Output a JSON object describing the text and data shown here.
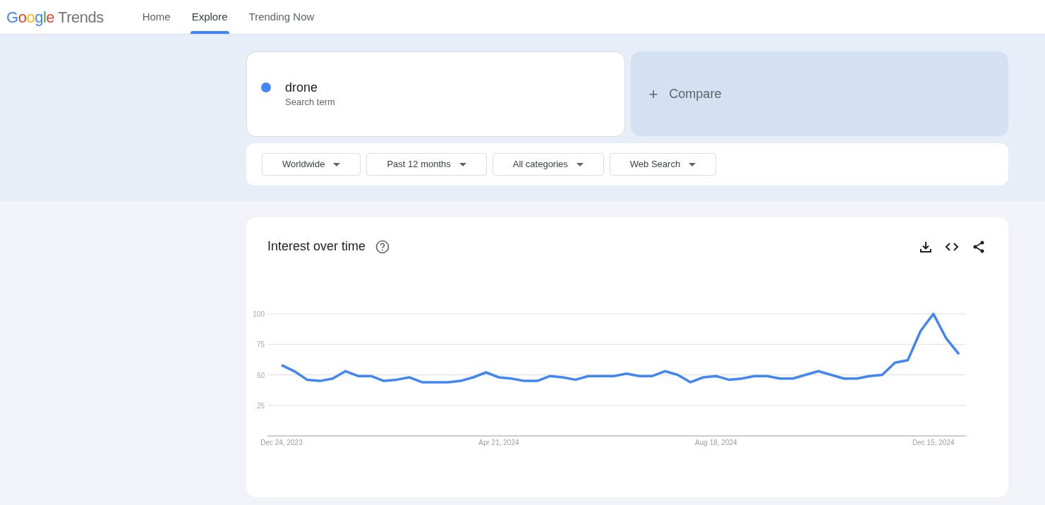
{
  "header": {
    "logo": {
      "brand": "Google",
      "product": "Trends"
    },
    "nav": [
      {
        "label": "Home",
        "selected": false
      },
      {
        "label": "Explore",
        "selected": true
      },
      {
        "label": "Trending Now",
        "selected": false
      }
    ]
  },
  "search_term": {
    "value": "drone",
    "caption": "Search term",
    "color": "#4285f4"
  },
  "compare": {
    "label": "Compare",
    "icon": "+"
  },
  "filters": [
    {
      "label": "Worldwide"
    },
    {
      "label": "Past 12 months"
    },
    {
      "label": "All categories"
    },
    {
      "label": "Web Search"
    }
  ],
  "interest_over_time": {
    "title": "Interest over time",
    "chart_data": {
      "type": "line",
      "categories": [
        "Dec 24, 2023",
        null,
        null,
        null,
        null,
        null,
        null,
        null,
        null,
        null,
        null,
        null,
        null,
        null,
        null,
        null,
        null,
        "Apr 21, 2024",
        null,
        null,
        null,
        null,
        null,
        null,
        null,
        null,
        null,
        null,
        null,
        null,
        null,
        null,
        null,
        null,
        "Aug 18, 2024",
        null,
        null,
        null,
        null,
        null,
        null,
        null,
        null,
        null,
        null,
        null,
        null,
        null,
        null,
        null,
        null,
        "Dec 15, 2024",
        null,
        null
      ],
      "series": [
        {
          "color": "#4285f4",
          "values": [
            58,
            53,
            46,
            45,
            47,
            53,
            49,
            49,
            45,
            46,
            48,
            44,
            44,
            44,
            45,
            48,
            52,
            48,
            47,
            45,
            45,
            49,
            48,
            46,
            49,
            49,
            49,
            51,
            49,
            49,
            53,
            50,
            44,
            48,
            49,
            46,
            47,
            49,
            49,
            47,
            47,
            50,
            53,
            50,
            47,
            47,
            49,
            50,
            60,
            62,
            86,
            100,
            80,
            67
          ]
        }
      ],
      "grid": true,
      "ylim": [
        0,
        100
      ],
      "yticks": [
        25,
        50,
        75,
        100
      ]
    }
  }
}
